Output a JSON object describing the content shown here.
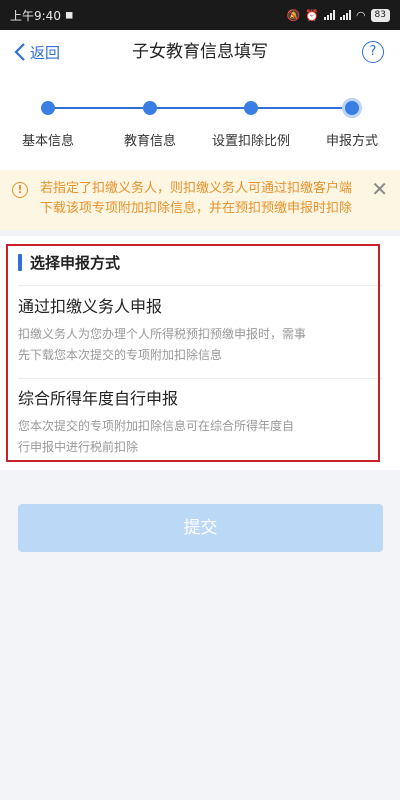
{
  "status_bar": {
    "time": "上午9:40",
    "battery": "83"
  },
  "nav": {
    "back_label": "返回",
    "title": "子女教育信息填写",
    "help_glyph": "?"
  },
  "stepper": {
    "steps": [
      "基本信息",
      "教育信息",
      "设置扣除比例",
      "申报方式"
    ],
    "current_step": 4
  },
  "notice": {
    "text": "若指定了扣缴义务人，则扣缴义务人可通过扣缴客户端下载该项专项附加扣除信息，并在预扣预缴申报时扣除",
    "icon": "!",
    "close": "✕"
  },
  "section": {
    "title": "选择申报方式",
    "options": [
      {
        "title": "通过扣缴义务人申报",
        "desc_line1": "扣缴义务人为您办理个人所得税预扣预缴申报时，需事",
        "desc_line2": "先下载您本次提交的专项附加扣除信息"
      },
      {
        "title": "综合所得年度自行申报",
        "desc_line1": "您本次提交的专项附加扣除信息可在综合所得年度自",
        "desc_line2": "行申报中进行税前扣除"
      }
    ]
  },
  "submit_label": "提交",
  "colors": {
    "accent": "#2f6fd6",
    "notice_text": "#e8922b",
    "notice_bg": "#fdf6e3",
    "highlight_frame": "#c8202b",
    "submit_disabled": "#bcd8f7"
  }
}
